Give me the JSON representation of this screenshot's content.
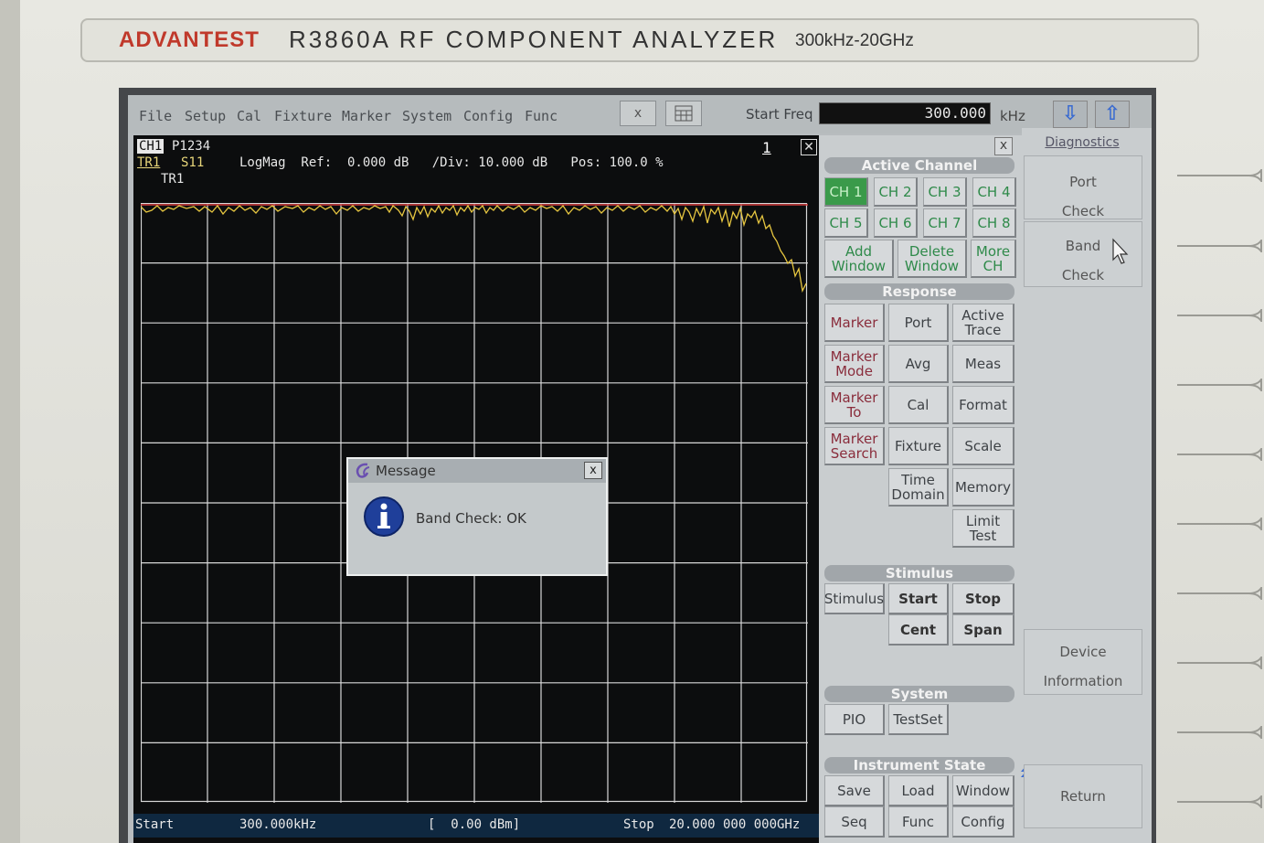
{
  "device": {
    "brand": "ADVANTEST",
    "model": "R3860A  RF COMPONENT ANALYZER",
    "range": "300kHz-20GHz"
  },
  "menubar": {
    "items": [
      "File",
      "Setup",
      "Cal",
      "Fixture",
      "Marker",
      "System",
      "Config",
      "Func"
    ],
    "close_label": "x",
    "start_freq_label": "Start Freq",
    "start_freq_value": "300.000",
    "start_freq_unit": "kHz"
  },
  "trace": {
    "ch": "CH1",
    "port": "P1234",
    "tr": "TR1",
    "param": "S11",
    "info": "LogMag  Ref:  0.000 dB   /Div: 10.000 dB   Pos: 100.0 %",
    "trace_label": "TR1",
    "window_num": "1",
    "footer_start_label": "Start",
    "footer_start_value": "300.000kHz",
    "footer_power": "[  0.00 dBm]",
    "footer_stop_label": "Stop",
    "footer_stop_value": "20.000 000 000GHz"
  },
  "dialog": {
    "title": "Message",
    "close": "x",
    "message": "Band Check: OK"
  },
  "panel": {
    "active_channel": "Active Channel",
    "channels": [
      "CH 1",
      "CH 2",
      "CH 3",
      "CH 4",
      "CH 5",
      "CH 6",
      "CH 7",
      "CH 8"
    ],
    "add_window": "Add Window",
    "delete_window": "Delete Window",
    "more_ch": "More CH",
    "response": "Response",
    "marker": "Marker",
    "port": "Port",
    "active_trace": "Active Trace",
    "marker_mode": "Marker Mode",
    "avg": "Avg",
    "meas": "Meas",
    "marker_to": "Marker To",
    "cal": "Cal",
    "format": "Format",
    "marker_search": "Marker Search",
    "fixture": "Fixture",
    "scale": "Scale",
    "time_domain": "Time Domain",
    "memory": "Memory",
    "limit_test": "Limit Test",
    "stimulus_section": "Stimulus",
    "stimulus": "Stimulus",
    "start": "Start",
    "stop": "Stop",
    "cent": "Cent",
    "span": "Span",
    "system_section": "System",
    "pio": "PIO",
    "testset": "TestSet",
    "instrument_state": "Instrument State",
    "save": "Save",
    "load": "Load",
    "window": "Window",
    "seq": "Seq",
    "func": "Func",
    "config": "Config",
    "close": "x"
  },
  "right_panel": {
    "diagnostics": "Diagnostics",
    "port_check": "Port Check",
    "band_check": "Band Check",
    "device_information": "Device Information",
    "return": "Return"
  },
  "colors": {
    "trace": "#e6c640",
    "grid": "#d8d8d8",
    "ref_line": "#d23a3a",
    "active_channel": "#3a9a4a"
  }
}
